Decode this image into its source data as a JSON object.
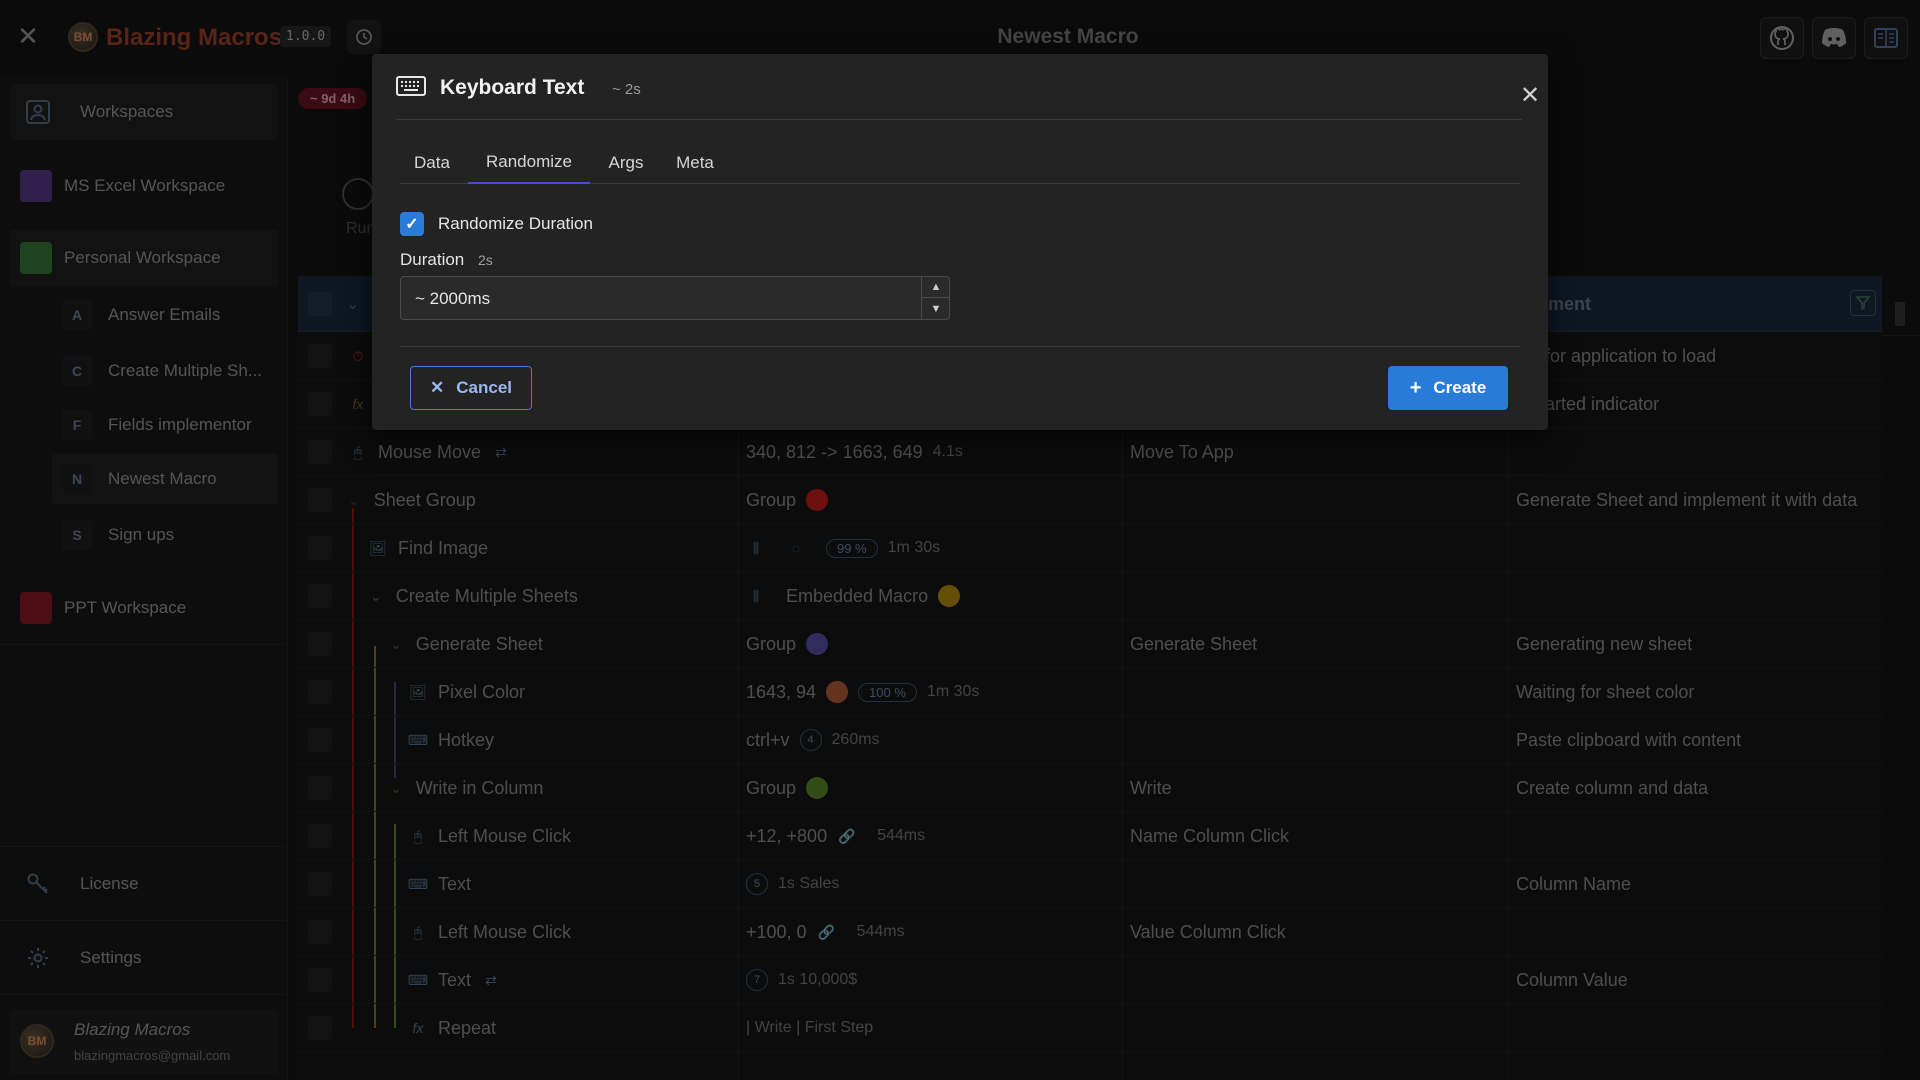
{
  "titlebar": {
    "app_name": "Blazing Macros",
    "version": "1.0.0",
    "window_title": "Newest Macro",
    "logo_text": "BM"
  },
  "sidebar": {
    "workspaces_label": "Workspaces",
    "workspaces": [
      {
        "label": "MS Excel Workspace",
        "color": "#5a3a8a"
      },
      {
        "label": "Personal Workspace",
        "color": "#3a7a3a"
      },
      {
        "label": "PPT Workspace",
        "color": "#8a1a24"
      }
    ],
    "macros": [
      {
        "letter": "A",
        "label": "Answer Emails"
      },
      {
        "letter": "C",
        "label": "Create Multiple Sh..."
      },
      {
        "letter": "F",
        "label": "Fields implementor"
      },
      {
        "letter": "N",
        "label": "Newest Macro"
      },
      {
        "letter": "S",
        "label": "Sign ups"
      }
    ],
    "license_label": "License",
    "settings_label": "Settings",
    "user": {
      "name": "Blazing Macros",
      "email": "blazingmacros@gmail.com"
    }
  },
  "main": {
    "tab_pill": "~ 9d 4h",
    "run_label": "Run",
    "table_header_comment": "ment",
    "rows": [
      {
        "name": "",
        "value": "",
        "label": "",
        "comment": "ing for application to load"
      },
      {
        "name": "",
        "value": "",
        "label": "",
        "comment": "o started indicator"
      },
      {
        "name": "Mouse Move",
        "value": "340, 812 -> 1663, 649",
        "value_extra": "4.1s",
        "label": "Move To App",
        "comment": ""
      },
      {
        "name": "Sheet Group",
        "value": "Group",
        "label": "",
        "comment": "Generate Sheet and implement it with data",
        "dot": "#c81e1e"
      },
      {
        "name": "Find Image",
        "value": "",
        "pct": "99 %",
        "value_extra": "1m 30s",
        "label": "",
        "comment": ""
      },
      {
        "name": "Create Multiple Sheets",
        "value": "Embedded Macro",
        "label": "",
        "comment": "",
        "dot": "#b8900c"
      },
      {
        "name": "Generate Sheet",
        "value": "Group",
        "label": "Generate Sheet",
        "comment": "Generating new sheet",
        "dot": "#5a50a8"
      },
      {
        "name": "Pixel Color",
        "value": "1643, 94",
        "pct": "100 %",
        "value_extra": "1m 30s",
        "label": "",
        "comment": "Waiting for sheet color",
        "dot": "#b8603c"
      },
      {
        "name": "Hotkey",
        "value": "ctrl+v",
        "num": "4",
        "value_extra": "260ms",
        "label": "",
        "comment": "Paste clipboard with content"
      },
      {
        "name": "Write in Column",
        "value": "Group",
        "label": "Write",
        "comment": "Create column and data",
        "dot": "#5a8a28"
      },
      {
        "name": "Left Mouse Click",
        "value": "+12, +800",
        "value_extra": "544ms",
        "label": "Name Column Click",
        "comment": ""
      },
      {
        "name": "Text",
        "value": "",
        "num": "5",
        "value_extra": "1s  Sales",
        "label": "",
        "comment": "Column Name"
      },
      {
        "name": "Left Mouse Click",
        "value": "+100, 0",
        "value_extra": "544ms",
        "label": "Value Column Click",
        "comment": ""
      },
      {
        "name": "Text",
        "value": "",
        "num": "7",
        "value_extra": "1s  10,000$",
        "label": "",
        "comment": "Column Value"
      },
      {
        "name": "Repeat",
        "value": "| Write | First Step",
        "label": "",
        "comment": ""
      }
    ]
  },
  "modal": {
    "title": "Keyboard Text",
    "subtitle": "~ 2s",
    "tabs": [
      "Data",
      "Randomize",
      "Args",
      "Meta"
    ],
    "active_tab": "Randomize",
    "randomize_label": "Randomize Duration",
    "duration_label": "Duration",
    "duration_hint": "2s",
    "duration_value": "~ 2000ms",
    "cancel_label": "Cancel",
    "create_label": "Create"
  },
  "colors": {
    "accent": "#2a7ad8",
    "brand": "#a4402a"
  }
}
